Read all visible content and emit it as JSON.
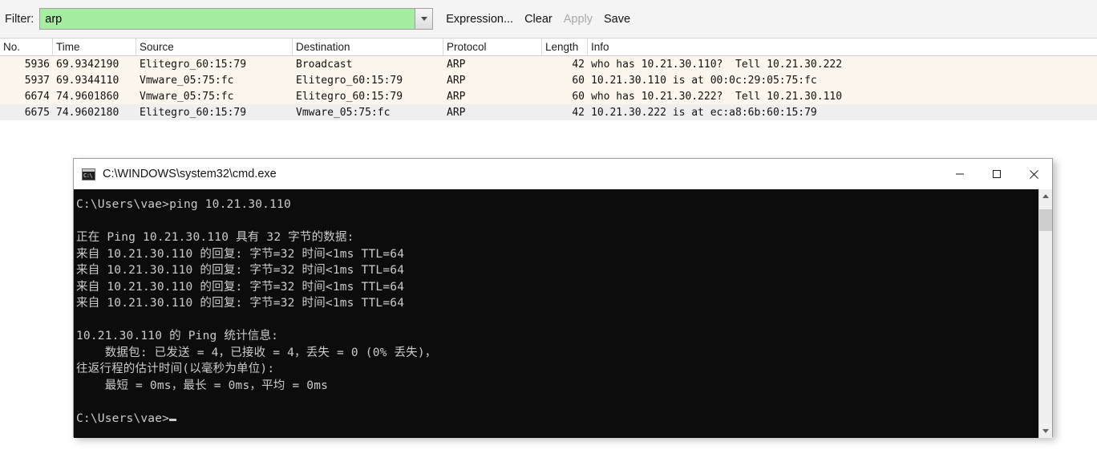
{
  "filter_bar": {
    "label": "Filter:",
    "filter_value": "arp",
    "filter_placeholder": "",
    "dropdown_icon": "chevron-down-icon",
    "buttons": [
      {
        "label": "Expression...",
        "disabled": false
      },
      {
        "label": "Clear",
        "disabled": false
      },
      {
        "label": "Apply",
        "disabled": true
      },
      {
        "label": "Save",
        "disabled": false
      }
    ],
    "filter_field_color": "#a5eda0"
  },
  "packet_list": {
    "columns": [
      "No.",
      "Time",
      "Source",
      "Destination",
      "Protocol",
      "Length",
      "Info"
    ],
    "rows": [
      {
        "no": "5936",
        "time": "69.9342190",
        "source": "Elitegro_60:15:79",
        "destination": "Broadcast",
        "protocol": "ARP",
        "length": "42",
        "info": "who has 10.21.30.110?  Tell 10.21.30.222",
        "style": "cream"
      },
      {
        "no": "5937",
        "time": "69.9344110",
        "source": "Vmware_05:75:fc",
        "destination": "Elitegro_60:15:79",
        "protocol": "ARP",
        "length": "60",
        "info": "10.21.30.110 is at 00:0c:29:05:75:fc",
        "style": "cream"
      },
      {
        "no": "6674",
        "time": "74.9601860",
        "source": "Vmware_05:75:fc",
        "destination": "Elitegro_60:15:79",
        "protocol": "ARP",
        "length": "60",
        "info": "who has 10.21.30.222?  Tell 10.21.30.110",
        "style": "cream"
      },
      {
        "no": "6675",
        "time": "74.9602180",
        "source": "Elitegro_60:15:79",
        "destination": "Vmware_05:75:fc",
        "protocol": "ARP",
        "length": "42",
        "info": "10.21.30.222 is at ec:a8:6b:60:15:79",
        "style": "gray"
      }
    ]
  },
  "cmd_window": {
    "title": "C:\\WINDOWS\\system32\\cmd.exe",
    "icon": "cmd-console-icon",
    "window_buttons": {
      "minimize": "minimize-icon",
      "maximize": "maximize-icon",
      "close": "close-icon"
    },
    "console_text": "C:\\Users\\vae>ping 10.21.30.110\n\n正在 Ping 10.21.30.110 具有 32 字节的数据:\n来自 10.21.30.110 的回复: 字节=32 时间<1ms TTL=64\n来自 10.21.30.110 的回复: 字节=32 时间<1ms TTL=64\n来自 10.21.30.110 的回复: 字节=32 时间<1ms TTL=64\n来自 10.21.30.110 的回复: 字节=32 时间<1ms TTL=64\n\n10.21.30.110 的 Ping 统计信息:\n    数据包: 已发送 = 4，已接收 = 4，丢失 = 0 (0% 丢失)，\n往返行程的估计时间(以毫秒为单位):\n    最短 = 0ms，最长 = 0ms，平均 = 0ms\n\nC:\\Users\\vae>",
    "scrollbar": {
      "up_arrow": "chevron-up-icon",
      "down_arrow": "chevron-down-icon"
    },
    "background_color": "#0c0c0c",
    "text_color": "#cccccc"
  }
}
